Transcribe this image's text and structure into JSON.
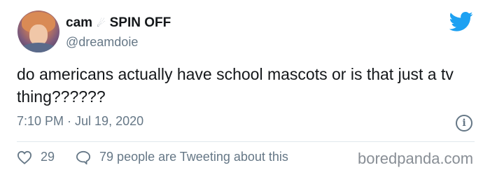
{
  "user": {
    "display_name": "cam",
    "title_suffix": "SPIN OFF",
    "handle": "@dreamdoie"
  },
  "icons": {
    "comet": "comet-icon",
    "bird": "twitter-bird-icon",
    "info": "info-icon",
    "like": "heart-icon",
    "reply": "speech-bubble-icon"
  },
  "tweet": {
    "text": "do americans actually have school mascots or is that just a tv thing??????",
    "timestamp": "7:10 PM · Jul 19, 2020"
  },
  "stats": {
    "likes": "29",
    "tweeting": "79 people are Tweeting about this"
  },
  "watermark": "boredpanda.com",
  "colors": {
    "twitter_blue": "#1da1f2",
    "text": "#14171a",
    "muted": "#657786"
  }
}
